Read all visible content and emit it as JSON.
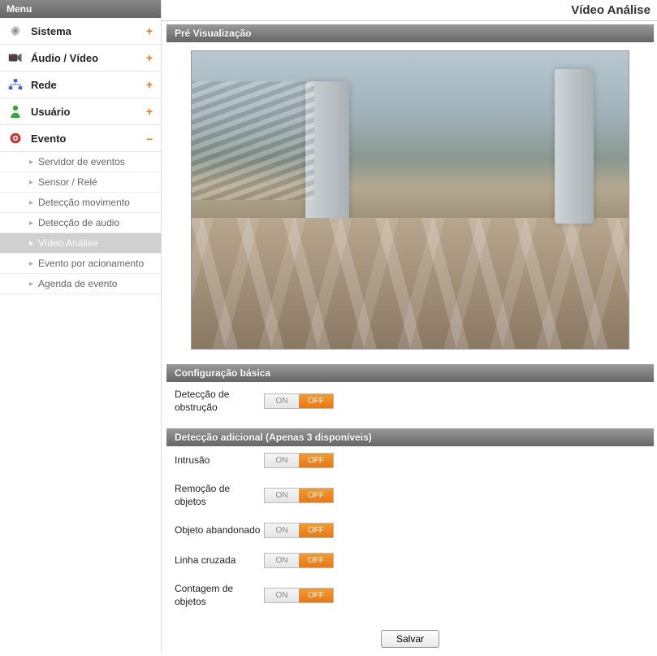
{
  "page_title": "Vídeo Análise",
  "sidebar": {
    "header": "Menu",
    "categories": [
      {
        "key": "sistema",
        "label": "Sistema",
        "expanded": false
      },
      {
        "key": "audio_video",
        "label": "Áudio / Vídeo",
        "expanded": false
      },
      {
        "key": "rede",
        "label": "Rede",
        "expanded": false
      },
      {
        "key": "usuario",
        "label": "Usuário",
        "expanded": false
      },
      {
        "key": "evento",
        "label": "Evento",
        "expanded": true
      }
    ],
    "evento_items": [
      {
        "label": "Servidor de eventos",
        "active": false
      },
      {
        "label": "Sensor / Relé",
        "active": false
      },
      {
        "label": "Detecção movimento",
        "active": false
      },
      {
        "label": "Detecção de audio",
        "active": false
      },
      {
        "label": "Vídeo Análise",
        "active": true
      },
      {
        "label": "Evento por acionamento",
        "active": false
      },
      {
        "label": "Agenda de evento",
        "active": false
      }
    ]
  },
  "sections": {
    "preview": {
      "title": "Pré Visualização"
    },
    "basic": {
      "title": "Configuração básica",
      "rows": [
        {
          "label": "Detecção de obstrução",
          "value": "OFF"
        }
      ]
    },
    "additional": {
      "title": "Detecção adicional (Apenas 3 disponíveis)",
      "rows": [
        {
          "label": "Intrusão",
          "value": "OFF"
        },
        {
          "label": "Remoção de objetos",
          "value": "OFF"
        },
        {
          "label": "Objeto abandonado",
          "value": "OFF"
        },
        {
          "label": "Linha cruzada",
          "value": "OFF"
        },
        {
          "label": "Contagem de objetos",
          "value": "OFF"
        }
      ]
    }
  },
  "toggle_labels": {
    "on": "ON",
    "off": "OFF"
  },
  "buttons": {
    "save": "Salvar"
  },
  "colors": {
    "accent": "#e67817",
    "header_grad_top": "#999999",
    "header_grad_bottom": "#666666"
  }
}
